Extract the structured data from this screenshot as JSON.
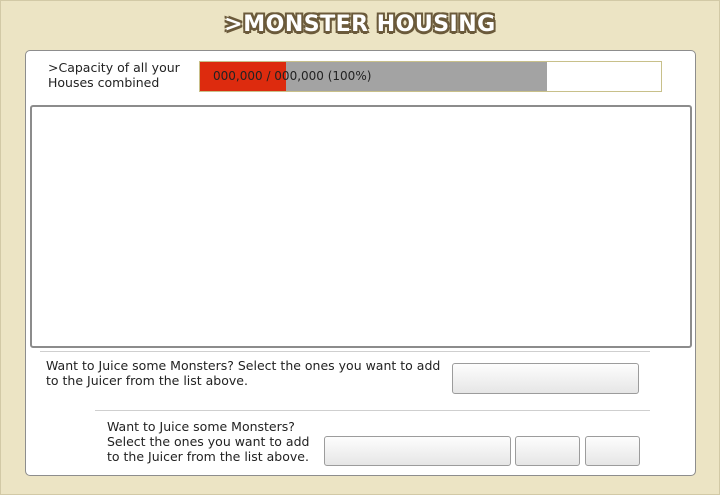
{
  "header": {
    "title": ">MONSTER HOUSING"
  },
  "capacity": {
    "label": ">Capacity of all your Houses combined",
    "value_text": "000,000 / 000,000 (100%)",
    "fill_fraction": 0.186,
    "track_fraction": 0.753,
    "fill_color": "#dd2b0e",
    "track_color": "#a3a3a3"
  },
  "monster_list": {
    "items": []
  },
  "juicer_section_1": {
    "text": "Want to Juice some Monsters? Select the ones you want to add to the Juicer from the list above.",
    "button_label": ""
  },
  "juicer_section_2": {
    "text": "Want to Juice some Monsters? Select the ones you want to add to the Juicer from the list above.",
    "button_1_label": "",
    "button_2_label": "",
    "button_3_label": ""
  }
}
